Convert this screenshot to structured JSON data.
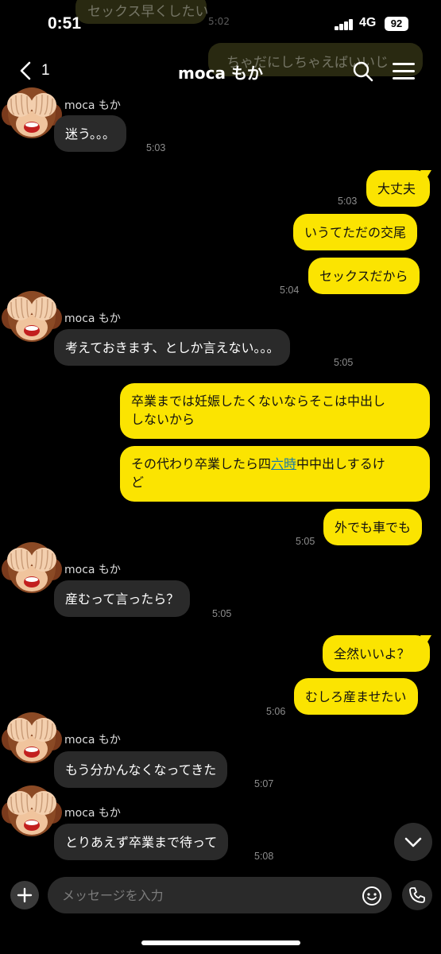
{
  "status": {
    "time": "0:51",
    "network": "4G",
    "battery": "92"
  },
  "ghost": {
    "text_top": "セックス早くしたい",
    "time_top": "5:02",
    "text_right": "ちゃだにしちゃえばいいじ"
  },
  "header": {
    "back_count": "1",
    "title": "moca もか"
  },
  "messages": [
    {
      "name": "moca もか",
      "text": "迷う。。。",
      "time": "5:03"
    },
    {
      "text": "大丈夫",
      "time": "5:03"
    },
    {
      "text": "いうてただの交尾"
    },
    {
      "text": "セックスだから",
      "time": "5:04"
    },
    {
      "name": "moca もか",
      "text": "考えておきます、としか言えない。。。",
      "time": "5:05"
    },
    {
      "line1": "卒業までは妊娠したくないならそこは中出し",
      "line2": "しないから"
    },
    {
      "line1_a": "その代わり卒業したら四",
      "line1_link": "六時",
      "line1_b": "中中出しするけ",
      "line2": "ど"
    },
    {
      "text": "外でも車でも",
      "time": "5:05"
    },
    {
      "name": "moca もか",
      "text": "産むって言ったら？",
      "time": "5:05"
    },
    {
      "text": "全然いいよ？"
    },
    {
      "text": "むしろ産ませたい",
      "time": "5:06"
    },
    {
      "name": "moca もか",
      "text": "もう分かんなくなってきた",
      "time": "5:07"
    },
    {
      "name": "moca もか",
      "text": "とりあえず卒業まで待って",
      "time": "5:08"
    }
  ],
  "composer": {
    "placeholder": "メッセージを入力"
  },
  "icons": {
    "back": "chevron-left-icon",
    "search": "search-icon",
    "menu": "menu-icon",
    "avatar": "see-no-evil-monkey-avatar",
    "scroll": "chevron-down-icon",
    "plus": "plus-icon",
    "emoji": "emoji-icon",
    "call": "phone-icon"
  },
  "colors": {
    "outgoing": "#fbe401",
    "incoming": "#2a2a2a",
    "background": "#000000"
  }
}
